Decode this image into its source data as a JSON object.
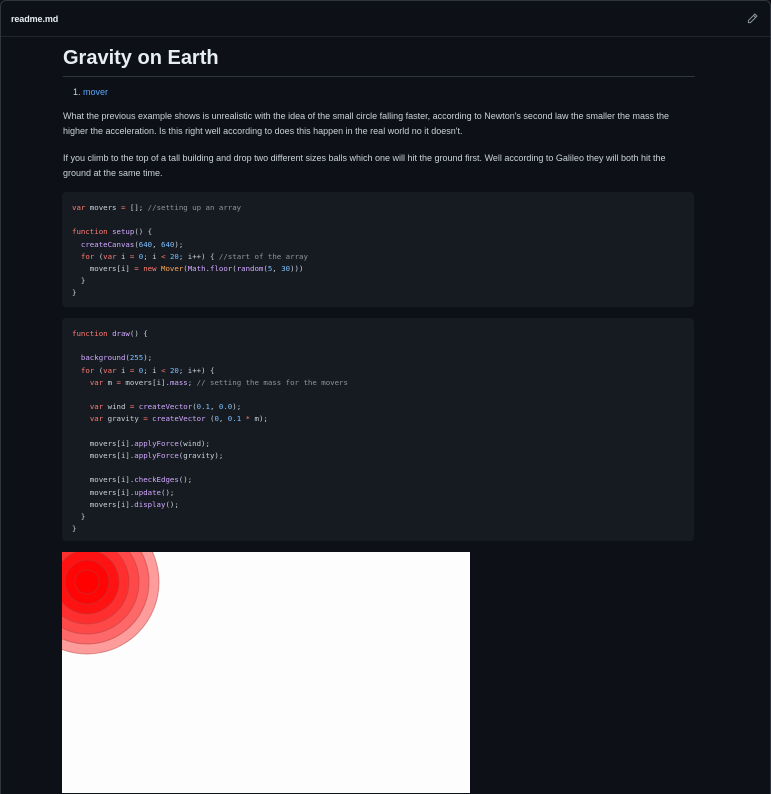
{
  "file": {
    "name": "readme.md",
    "edit_icon": "pencil-icon"
  },
  "readme": {
    "title": "Gravity on Earth",
    "list": [
      {
        "label": "mover"
      }
    ],
    "paragraphs": [
      "What the previous example shows is unrealistic with the idea of the small circle falling faster, according to Newton's second law the smaller the mass the higher the acceleration. Is this right well according to does this happen in the real world no it doesn't.",
      "If you climb to the top of a tall building and drop two different sizes balls which one will hit the ground first. Well according to Galileo they will both hit the ground at the same time."
    ],
    "code_blocks": [
      {
        "lines": [
          "var movers = []; //setting up an array",
          "",
          "function setup() {",
          "  createCanvas(640, 640);",
          "  for (var i = 0; i < 20; i++) { //start of the array",
          "    movers[i] = new Mover(Math.floor(random(5, 30)))",
          "  }",
          "}"
        ]
      },
      {
        "lines": [
          "function draw() {",
          "",
          "  background(255);",
          "  for (var i = 0; i < 20; i++) {",
          "    var m = movers[i].mass; // setting the mass for the movers",
          "",
          "    var wind = createVector(0.1, 0.0);",
          "    var gravity = createVector (0, 0.1 * m);",
          "",
          "    movers[i].applyForce(wind);",
          "    movers[i].applyForce(gravity);",
          "",
          "    movers[i].checkEdges();",
          "    movers[i].update();",
          "    movers[i].display();",
          "  }",
          "}"
        ]
      }
    ],
    "image": {
      "description_icon": "sketch-output-image",
      "circle_color": "#ff0000"
    }
  },
  "colors": {
    "background": "#0d1117",
    "code_bg": "#161b22",
    "link": "#58a6ff",
    "keyword": "#ff7b72",
    "function": "#d2a8ff",
    "number": "#79c0ff",
    "comment": "#8b949e"
  }
}
